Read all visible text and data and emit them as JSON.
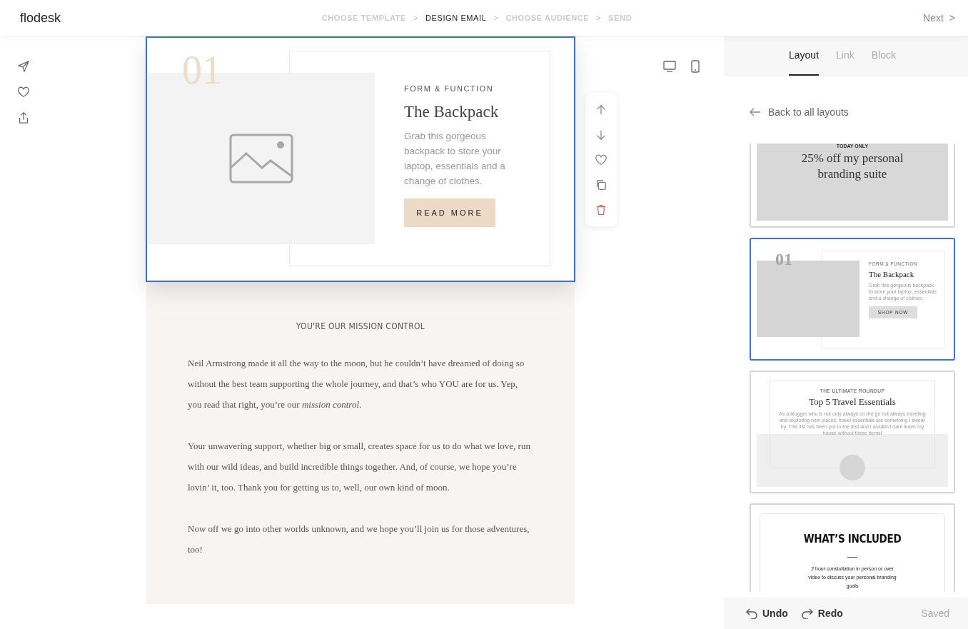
{
  "header": {
    "logo": "flodesk",
    "separator": ">",
    "steps": [
      {
        "label": "CHOOSE TEMPLATE",
        "selected": false
      },
      {
        "label": "DESIGN EMAIL",
        "selected": true
      },
      {
        "label": "CHOOSE AUDIENCE",
        "selected": false
      },
      {
        "label": "SEND",
        "selected": false
      }
    ],
    "next": {
      "label": "Next",
      "arrow": ">"
    }
  },
  "email": {
    "selected_block": {
      "number": "01",
      "eyebrow": "FORM & FUNCTION",
      "title": "The Backpack",
      "body": "Grab this gorgeous backpack to store your laptop, essentials and a change of clothes.",
      "button": "READ MORE"
    },
    "section": {
      "heading": "YOU'RE OUR MISSION CONTROL",
      "paragraphs": [
        "Neil Armstrong made it all the way to the moon, but he couldn’t have dreamed of doing so without the best team supporting the whole journey, and that’s who YOU are for us. Yep, you read that right, you’re our *mission control*.",
        "Your unwavering support, whether big or small, creates space for us to do what we love, run with our wild ideas, and build incredible things together. And, of course, we hope you’re lovin’ it, too. Thank you for getting us to, well, our own kind of moon.",
        "Now off we go into other worlds unknown, and we hope you’ll join us for those adventures, too!"
      ]
    }
  },
  "panel": {
    "tabs": [
      {
        "label": "Layout",
        "selected": true
      },
      {
        "label": "Link",
        "selected": false
      },
      {
        "label": "Block",
        "selected": false
      }
    ],
    "back_link": "Back to all layouts",
    "layouts": [
      {
        "kind": "promo",
        "selected": false,
        "eyebrow": "TODAY ONLY",
        "title": "25% off my personal branding suite"
      },
      {
        "kind": "feature",
        "selected": true,
        "number": "01",
        "eyebrow": "FORM & FUNCTION",
        "title": "The Backpack",
        "body": "Grab this gorgeous backpack to store your laptop, essentials and a change of clothes.",
        "button": "SHOP NOW"
      },
      {
        "kind": "roundup",
        "selected": false,
        "eyebrow": "THE ULTIMATE ROUNDUP",
        "title": "Top 5 Travel Essentials",
        "body": "As a blogger who is not only always on the go but always traveling and exploring new places, travel essentials are something I swear by. This list has been put to the test and I wouldn’t dare leave my house without these items!"
      },
      {
        "kind": "list",
        "selected": false,
        "title": "WHAT’S INCLUDED",
        "body": "2 hour constultation in person or over video to discuss your personal branding goals"
      }
    ],
    "footer": {
      "undo": "Undo",
      "redo": "Redo",
      "status": "Saved"
    }
  }
}
